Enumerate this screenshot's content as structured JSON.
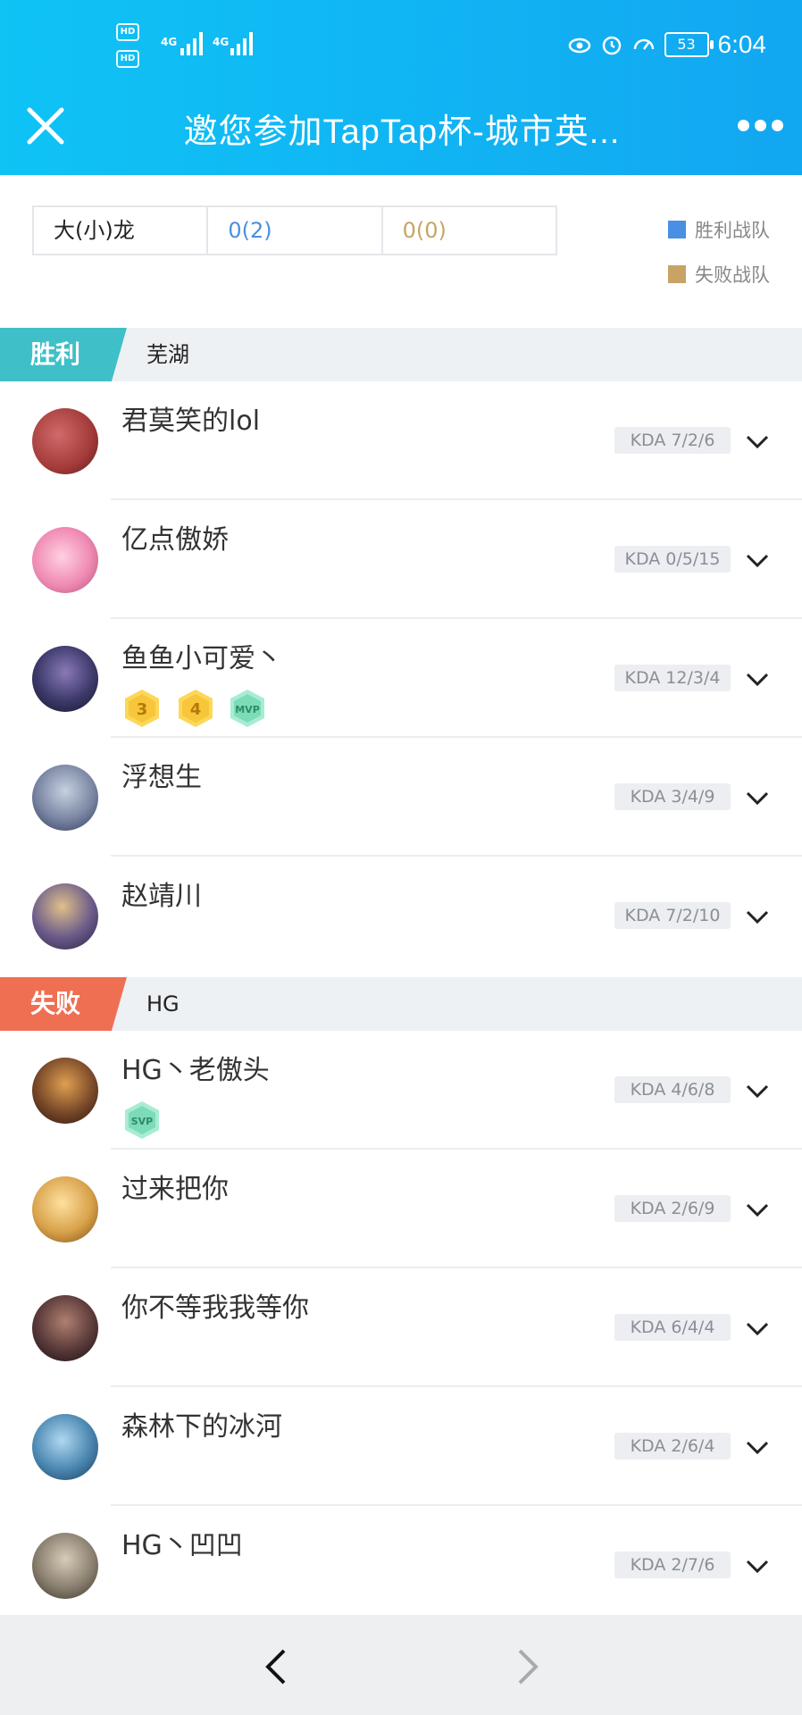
{
  "status_bar": {
    "time": "6:04",
    "battery": "53",
    "network1": "4G",
    "network2": "4G",
    "hd1": "HD",
    "hd2": "HD"
  },
  "header": {
    "title": "邀您参加TapTap杯-城市英..."
  },
  "score": {
    "team": "大(小)龙",
    "wins": "0(2)",
    "losses": "0(0)"
  },
  "legend": {
    "win_label": "胜利战队",
    "lose_label": "失败战队",
    "win_color": "#4a90e2",
    "lose_color": "#c8a464"
  },
  "teams": [
    {
      "result": "胜利",
      "color": "#3fc0c9",
      "name": "芜湖",
      "players": [
        {
          "name": "君莫笑的lol",
          "kda": "KDA 7/2/6",
          "avatar_color": "#a43a3a"
        },
        {
          "name": "亿点傲娇",
          "kda": "KDA 0/5/15",
          "avatar_color": "#f08bb5"
        },
        {
          "name": "鱼鱼小可爱丶",
          "kda": "KDA 12/3/4",
          "avatar_color": "#3d3a6b",
          "medals": [
            "3",
            "4",
            "MVP"
          ]
        },
        {
          "name": "浮想生",
          "kda": "KDA 3/4/9",
          "avatar_color": "#7a86a3"
        },
        {
          "name": "赵靖川",
          "kda": "KDA 7/2/10",
          "avatar_color": "#6a5a8a"
        }
      ]
    },
    {
      "result": "失败",
      "color": "#ef6f53",
      "name": "HG",
      "players": [
        {
          "name": "HG丶老傲头",
          "kda": "KDA 4/6/8",
          "avatar_color": "#7a4a2a",
          "medals": [
            "SVP"
          ]
        },
        {
          "name": "过来把你",
          "kda": "KDA 2/6/9",
          "avatar_color": "#d8a24a"
        },
        {
          "name": "你不等我我等你",
          "kda": "KDA 6/4/4",
          "avatar_color": "#5a3a3a"
        },
        {
          "name": "森林下的冰河",
          "kda": "KDA 2/6/4",
          "avatar_color": "#4a86b0"
        },
        {
          "name": "HG丶凹凹",
          "kda": "KDA 2/7/6",
          "avatar_color": "#8a8070"
        }
      ]
    }
  ]
}
